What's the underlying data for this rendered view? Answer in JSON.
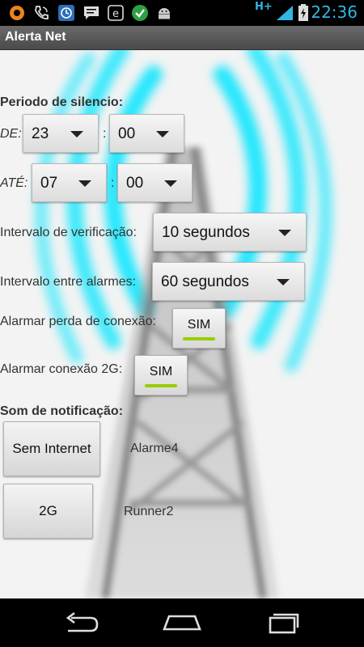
{
  "status_bar": {
    "time": "22:36",
    "network_type": "H+",
    "icons": [
      "ubuntu-one-icon",
      "phone-icon",
      "clock-sync-icon",
      "sms-icon",
      "evernote-icon",
      "check-icon",
      "android-icon",
      "signal-icon",
      "battery-charging-icon"
    ],
    "accent_color": "#33b5e5"
  },
  "app": {
    "title": "Alerta Net"
  },
  "silence": {
    "heading": "Periodo de silencio:",
    "from_label": "DE:",
    "to_label": "ATÉ:",
    "separator": ":",
    "from_hour": "23",
    "from_minute": "00",
    "to_hour": "07",
    "to_minute": "00"
  },
  "check_interval": {
    "label": "Intervalo de verificação:",
    "value": "10 segundos"
  },
  "alarm_interval": {
    "label": "Intervalo entre alarmes:",
    "value": "60 segundos"
  },
  "alarm_connection_loss": {
    "label": "Alarmar perda de conexão:",
    "toggle": "SIM"
  },
  "alarm_2g": {
    "label": "Alarmar conexão 2G:",
    "toggle": "SIM"
  },
  "notification_sound": {
    "heading": "Som de notificação:",
    "no_internet_button": "Sem Internet",
    "no_internet_sound": "Alarme4",
    "twog_button": "2G",
    "twog_sound": "Runner2"
  },
  "colors": {
    "toggle_on": "#99cc00",
    "tower_glow": "#00e5ff"
  },
  "nav_bar": {
    "buttons": [
      "back-icon",
      "home-icon",
      "recent-apps-icon"
    ]
  }
}
